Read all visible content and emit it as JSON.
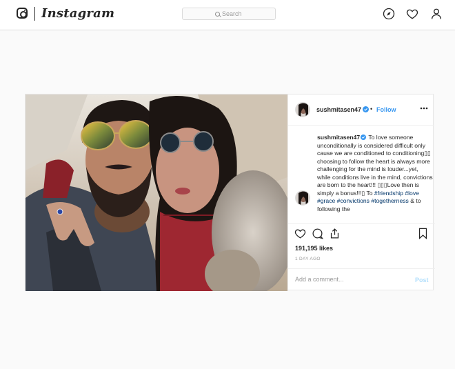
{
  "header": {
    "wordmark": "Instagram",
    "search_placeholder": "Search",
    "icons": [
      "instagram-logo-icon",
      "compass-icon",
      "heart-icon",
      "profile-icon"
    ]
  },
  "post": {
    "username": "sushmitasen47",
    "separator": "•",
    "follow_label": "Follow",
    "caption": {
      "username": "sushmitasen47",
      "text_1": " To love someone unconditionally is considered difficult only cause we are conditioned to conditioning",
      "text_2": " choosing to follow the heart is always more challenging for the mind is louder...yet, while conditions live in the mind, convictions are born to the heart!!! ",
      "text_3": "Love then is simply a bonus!!!",
      "text_4": " To ",
      "hashtags": [
        "#friendship",
        "#love",
        "#grace",
        "#convictions",
        "#togetherness"
      ],
      "tail": " & to following the"
    },
    "likes": "191,195 likes",
    "age": "1 DAY AGO",
    "comment_placeholder": "Add a comment...",
    "post_label": "Post"
  },
  "colors": {
    "link_blue": "#3897f0",
    "hashtag_blue": "#003569",
    "border": "#dbdbdb",
    "background": "#fafafa"
  }
}
